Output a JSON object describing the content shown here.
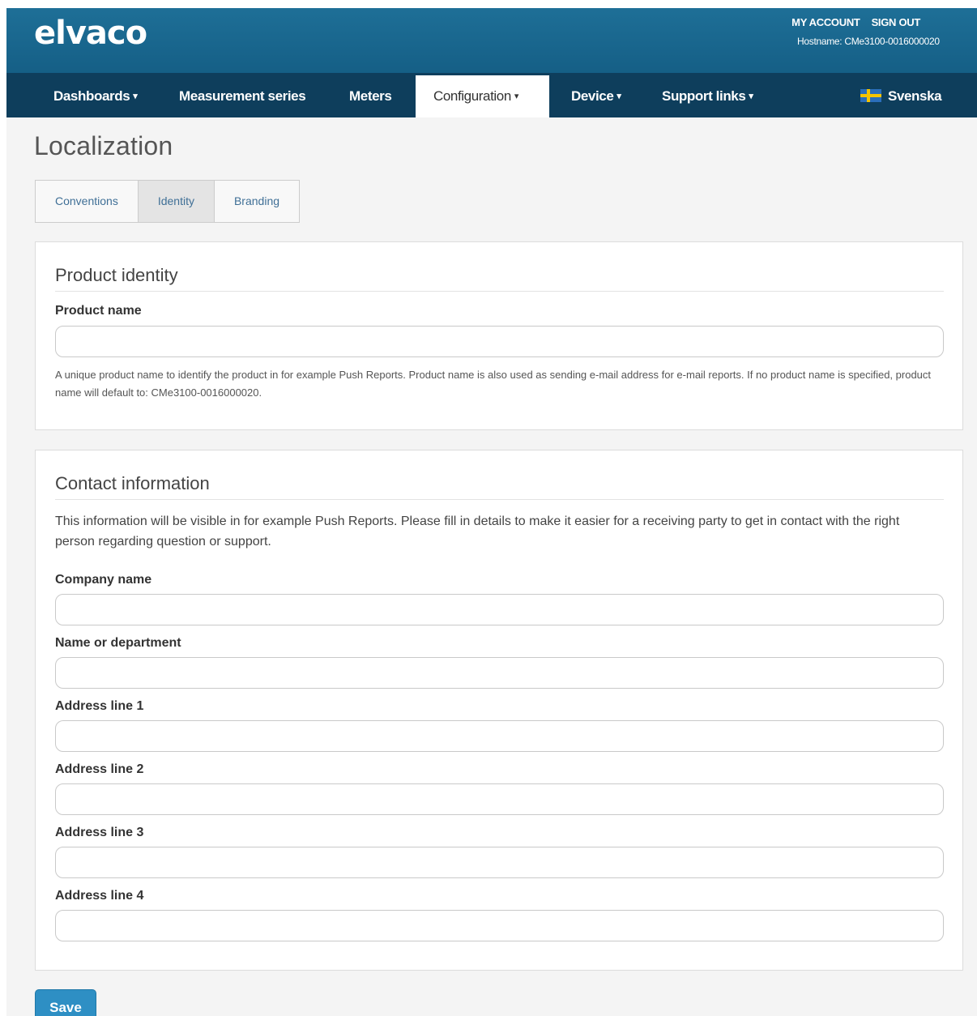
{
  "header": {
    "logo": "elvaco",
    "my_account": "MY ACCOUNT",
    "sign_out": "SIGN OUT",
    "hostname": "Hostname: CMe3100-0016000020"
  },
  "nav": {
    "items": [
      {
        "label": "Dashboards",
        "caret": "▾"
      },
      {
        "label": "Measurement series"
      },
      {
        "label": "Meters"
      },
      {
        "label": "Configuration",
        "caret": "▾",
        "active": true
      },
      {
        "label": "Device",
        "caret": "▾"
      },
      {
        "label": "Support links",
        "caret": "▾"
      }
    ],
    "language": "Svenska",
    "language_icon": "swedish-flag-icon"
  },
  "page": {
    "title": "Localization",
    "tabs": [
      {
        "label": "Conventions"
      },
      {
        "label": "Identity",
        "active": true
      },
      {
        "label": "Branding"
      }
    ]
  },
  "product_identity": {
    "title": "Product identity",
    "product_name_label": "Product name",
    "product_name_value": "",
    "help": "A unique product name to identify the product in for example Push Reports. Product name is also used as sending e-mail address for e-mail reports. If no product name is specified, product name will default to: CMe3100-0016000020."
  },
  "contact_information": {
    "title": "Contact information",
    "description": "This information will be visible in for example Push Reports. Please fill in details to make it easier for a receiving party to get in contact with the right person regarding question or support.",
    "fields": [
      {
        "label": "Company name",
        "value": ""
      },
      {
        "label": "Name or department",
        "value": ""
      },
      {
        "label": "Address line 1",
        "value": ""
      },
      {
        "label": "Address line 2",
        "value": ""
      },
      {
        "label": "Address line 3",
        "value": ""
      },
      {
        "label": "Address line 4",
        "value": ""
      }
    ]
  },
  "actions": {
    "save_label": "Save",
    "accent_color": "#2e8fc4"
  },
  "colors": {
    "header": "#1a6890",
    "nav": "#0e3e5c",
    "background": "#f4f4f4"
  }
}
